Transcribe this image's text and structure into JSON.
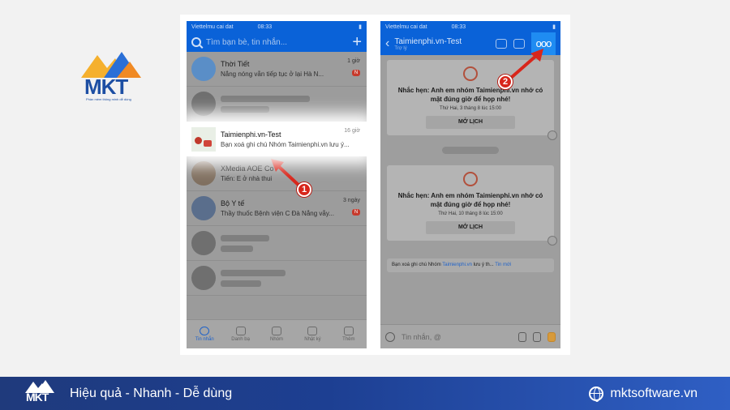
{
  "brand": {
    "logo_text": "MKT",
    "logo_tagline": "Phần mềm thông minh dễ dùng",
    "colors": {
      "primary": "#1d4fa3",
      "accent": "#f5b02e",
      "footer": "#1d3f92"
    }
  },
  "left_phone": {
    "status": {
      "carrier": "Viettelmu cai dat",
      "time": "08:33"
    },
    "search_placeholder": "Tìm bạn bè, tin nhắn...",
    "chats": [
      {
        "name": "Thời Tiết",
        "time": "1 giờ",
        "message": "Nắng nóng vẫn tiếp tục ở lại Hà N...",
        "badge": "N"
      },
      {
        "name": "",
        "time": "",
        "message": ""
      },
      {
        "name": "Taimienphi.vn-Test",
        "time": "16 giờ",
        "message": "Bạn xoá ghi chú Nhóm Taimienphi.vn lưu ý...",
        "highlighted": true
      },
      {
        "name": "XMedia AOE Co",
        "time": "",
        "message": "Tiến: E ở nhà thui"
      },
      {
        "name": "Bộ Y tế",
        "time": "3 ngày",
        "message": "Thầy thuốc Bệnh viện C Đà Nẵng vẫy...",
        "badge": "N"
      },
      {
        "name": "",
        "time": "",
        "message": ""
      },
      {
        "name": "",
        "time": "",
        "message": ""
      }
    ],
    "tabs": [
      {
        "label": "Tin nhắn",
        "icon": "chat-icon",
        "active": true
      },
      {
        "label": "Danh bạ",
        "icon": "contacts-icon"
      },
      {
        "label": "Nhóm",
        "icon": "group-icon"
      },
      {
        "label": "Nhật ký",
        "icon": "clock-icon"
      },
      {
        "label": "Thêm",
        "icon": "grid-icon"
      }
    ]
  },
  "right_phone": {
    "status": {
      "carrier": "Viettelmu cai dat",
      "time": "08:33"
    },
    "title": "Taimienphi.vn-Test",
    "subtitle": "Trợ lý",
    "more_label": "ooo",
    "reminders": [
      {
        "text": "Nhắc hẹn: Anh em nhóm Taimienphi.vn nhớ có mặt đúng giờ để họp nhé!",
        "date": "Thứ Hai, 3 tháng 8 lúc 15:00",
        "button": "MỞ LỊCH"
      },
      {
        "text": "Nhắc hẹn: Anh em nhóm Taimienphi.vn nhớ có mặt đúng giờ để họp nhé!",
        "date": "Thứ Hai, 10 tháng 8 lúc 15:00",
        "button": "MỞ LỊCH"
      }
    ],
    "notice": {
      "prefix": "Bạn xoá ghi chú Nhóm",
      "link": "Taimienphi.vn",
      "suffix": "lưu ý th...",
      "more": "Tin mới"
    },
    "input_placeholder": "Tin nhắn, @"
  },
  "annotations": {
    "step1": "1",
    "step2": "2"
  },
  "footer": {
    "slogan": "Hiệu quả - Nhanh - Dễ dùng",
    "website": "mktsoftware.vn"
  }
}
